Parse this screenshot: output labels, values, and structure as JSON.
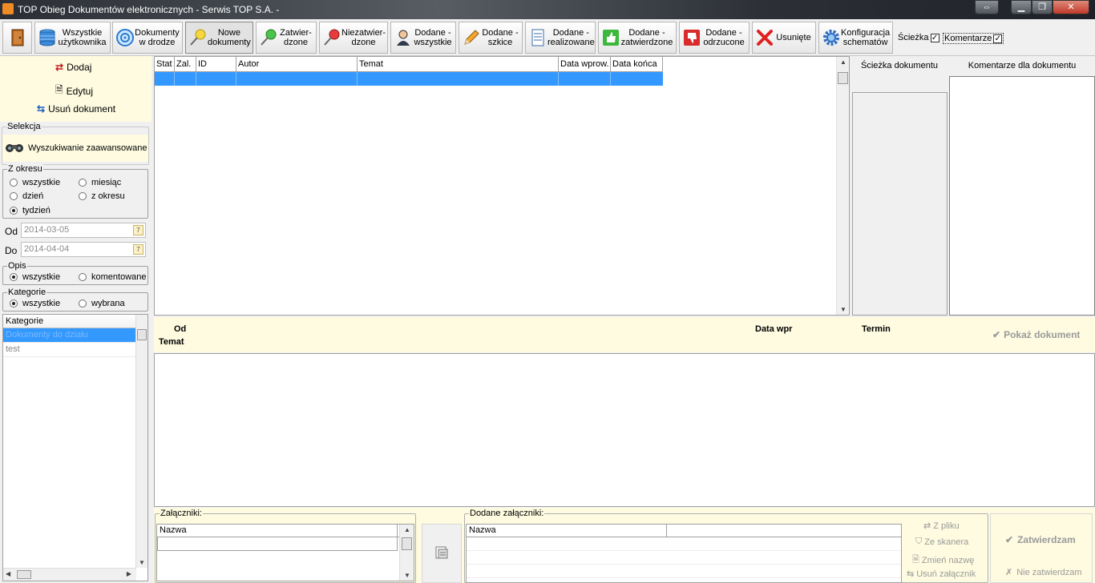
{
  "window": {
    "title": "TOP Obieg Dokumentów elektronicznych - Serwis TOP S.A. -"
  },
  "toolbar": {
    "buttons": [
      {
        "label": "",
        "icon": "door-icon"
      },
      {
        "label": "Wszystkie\nużytkownika",
        "icon": "database-icon"
      },
      {
        "label": "Dokumenty\nw drodze",
        "icon": "cd-icon"
      },
      {
        "label": "Nowe\ndokumenty",
        "icon": "pin-yellow-icon"
      },
      {
        "label": "Zatwier-\ndzone",
        "icon": "pin-green-icon"
      },
      {
        "label": "Niezatwier-\ndzone",
        "icon": "pin-red-icon"
      },
      {
        "label": "Dodane -\nwszystkie",
        "icon": "user-icon"
      },
      {
        "label": "Dodane -\nszkice",
        "icon": "pencil-icon"
      },
      {
        "label": "Dodane -\nrealizowane",
        "icon": "document-icon"
      },
      {
        "label": "Dodane -\nzatwierdzone",
        "icon": "thumbs-up-icon"
      },
      {
        "label": "Dodane -\nodrzucone",
        "icon": "thumbs-down-icon"
      },
      {
        "label": "Usunięte",
        "icon": "x-icon"
      },
      {
        "label": "Konfiguracja\nschematów",
        "icon": "gear-icon"
      }
    ],
    "checkbox_path": "Ścieżka",
    "checkbox_comments": "Komentarze",
    "check_mark": "✓"
  },
  "left": {
    "actions": {
      "add": "Dodaj",
      "edit": "Edytuj",
      "delete": "Usuń dokument"
    },
    "selection": {
      "title": "Selekcja",
      "advanced": "Wyszukiwanie zaawansowane"
    },
    "period": {
      "title": "Z okresu",
      "options": [
        {
          "label": "wszystkie",
          "selected": false
        },
        {
          "label": "miesiąc",
          "selected": false
        },
        {
          "label": "dzień",
          "selected": false
        },
        {
          "label": "z okresu",
          "selected": false
        },
        {
          "label": "tydzień",
          "selected": true
        }
      ]
    },
    "dates": {
      "from_label": "Od",
      "from": "2014-03-05",
      "to_label": "Do",
      "to": "2014-04-04",
      "cal_icon": "7"
    },
    "opis": {
      "title": "Opis",
      "all": "wszystkie",
      "commented": "komentowane"
    },
    "category_filter": {
      "title": "Kategorie",
      "all": "wszystkie",
      "chosen": "wybrana"
    },
    "category_list": {
      "header": "Kategorie",
      "items": [
        "Dokumenty do działu",
        "test"
      ]
    }
  },
  "grid": {
    "columns": [
      "Stat",
      "Zal.",
      "ID",
      "Autor",
      "Temat",
      "Data wprow.",
      "Data końca"
    ]
  },
  "right": {
    "path_title": "Ścieżka dokumentu",
    "comments_title": "Komentarze dla dokumentu"
  },
  "detail": {
    "from": "Od",
    "subject": "Temat",
    "date_in": "Data wpr",
    "deadline": "Termin",
    "show_document": "Pokaż dokument",
    "check_icon": "✔"
  },
  "attachments": {
    "title": "Załączniki:",
    "column": "Nazwa",
    "added_title": "Dodane załączniki:",
    "added_column": "Nazwa",
    "from_file": "Z pliku",
    "from_scanner": "Ze skanera",
    "rename": "Zmień nazwę",
    "remove": "Usuń załącznik",
    "approve": "Zatwierdzam",
    "reject": "Nie zatwierdzam",
    "approve_icon": "✔",
    "reject_icon": "✗"
  }
}
